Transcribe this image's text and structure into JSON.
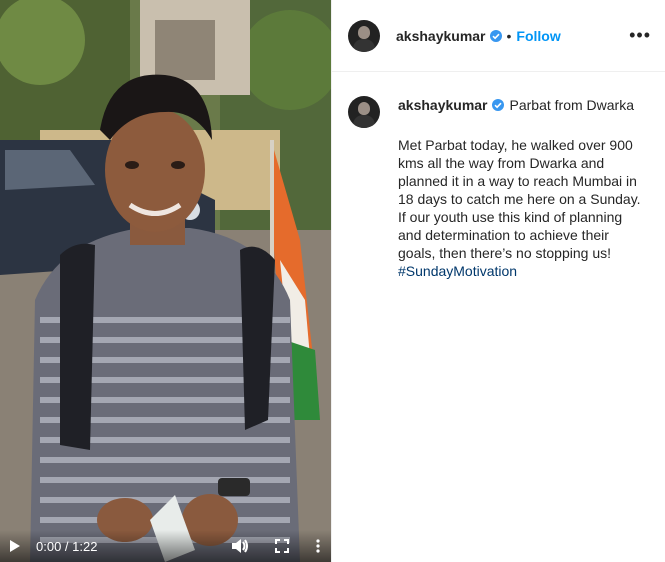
{
  "video": {
    "time": "0:00 / 1:22"
  },
  "post": {
    "username": "akshaykumar",
    "dot": "•",
    "follow_label": "Follow",
    "more": "•••",
    "caption_title": "Parbat from Dwarka",
    "caption_text": "Met Parbat today, he walked over 900 kms all the way from Dwarka and planned it in a way to reach Mumbai in 18 days to catch me here on a Sunday. If our youth use this kind of planning and determination to achieve their goals, then there’s no stopping us! ",
    "hashtag": "#SundayMotivation"
  },
  "colors": {
    "accent": "#0095f6",
    "hashtag": "#00376b",
    "verified": "#3897f0"
  },
  "icons": {
    "play": "play-icon",
    "volume": "volume-icon",
    "fullscreen": "fullscreen-icon",
    "more_vertical": "more-vertical-icon",
    "verified": "verified-badge-icon",
    "more": "more-options-icon"
  }
}
